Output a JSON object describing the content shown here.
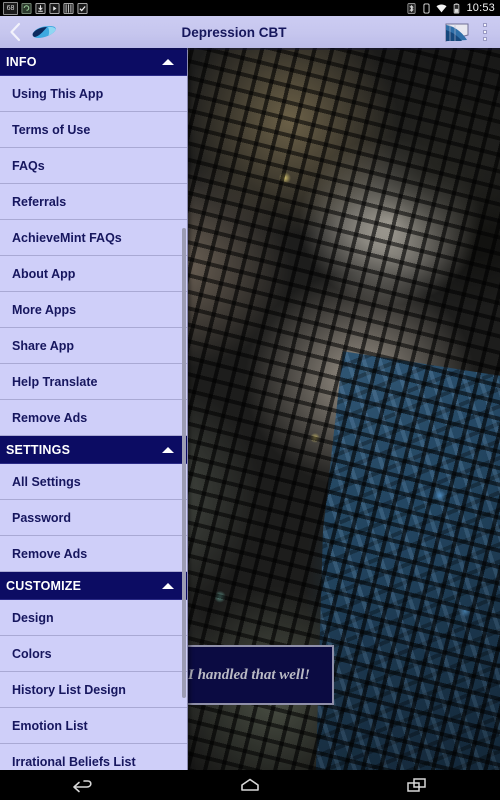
{
  "statusbar": {
    "temperature_badge": "68",
    "left_icons": [
      "temperature-badge",
      "sync-icon",
      "download-icon",
      "screen-record-icon",
      "keyboard-icon",
      "task-complete-icon"
    ],
    "right_icons": [
      "bluetooth-icon",
      "vibrate-icon",
      "wifi-icon",
      "battery-icon"
    ],
    "clock": "10:53"
  },
  "actionbar": {
    "back_icon": "back-chevron-icon",
    "app_logo": "butterfly-logo-icon",
    "title": "Depression CBT",
    "action_icon": "chart-icon",
    "overflow_icon": "overflow-menu-icon"
  },
  "drawer": {
    "scrollbar": "drawer-scrollbar",
    "sections": [
      {
        "header": "INFO",
        "collapse_icon": "chevron-up-icon",
        "items": [
          "Using This App",
          "Terms of Use",
          "FAQs",
          "Referrals",
          "AchieveMint FAQs",
          "About App",
          "More Apps",
          "Share App",
          "Help Translate",
          "Remove Ads"
        ]
      },
      {
        "header": "SETTINGS",
        "collapse_icon": "chevron-up-icon",
        "items": [
          "All Settings",
          "Password",
          "Remove Ads"
        ]
      },
      {
        "header": "CUSTOMIZE",
        "collapse_icon": "chevron-up-icon",
        "items": [
          "Design",
          "Colors",
          "History List Design",
          "Emotion List",
          "Irrational Beliefs List"
        ]
      }
    ]
  },
  "toast": {
    "message": "I handled that well!"
  },
  "navbar": {
    "buttons": [
      "back-nav-icon",
      "home-nav-icon",
      "recents-nav-icon"
    ]
  },
  "colors": {
    "accent_dark": "#0c0c63",
    "drawer_bg": "#cfcff9",
    "actionbar_bg": "#c9c9f2",
    "text_navy": "#16165e",
    "toast_bg": "#0b0b42",
    "toast_text": "#b9b9c4"
  }
}
